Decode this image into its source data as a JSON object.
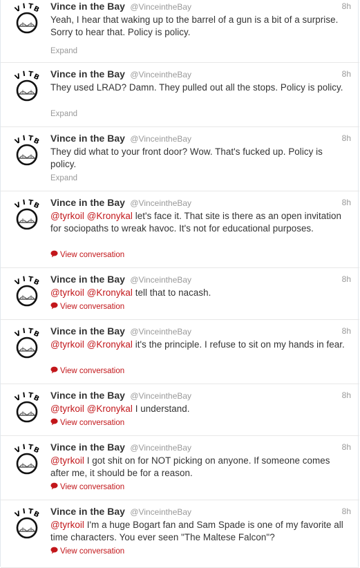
{
  "user": {
    "fullname": "Vince in the Bay",
    "username": "@VinceintheBay",
    "avatar_letters": [
      "V",
      "I",
      "T",
      "B"
    ]
  },
  "labels": {
    "expand": "Expand",
    "view_conversation": "View conversation"
  },
  "colors": {
    "link": "#c2161a",
    "muted": "#999999",
    "text": "#333333"
  },
  "icons": {
    "conversation": "speech-bubble-icon"
  },
  "tweets": [
    {
      "time": "8h",
      "mentions": [],
      "text": "Yeah, I hear that waking up to the barrel of a gun is a bit of a surprise. Sorry to hear that. Policy is policy.",
      "action": "expand"
    },
    {
      "time": "8h",
      "mentions": [],
      "text": "They used LRAD? Damn. They pulled out all the stops. Policy is policy.",
      "action": "expand"
    },
    {
      "time": "8h",
      "mentions": [],
      "text": "They did what to your front door? Wow. That's fucked up. Policy is policy.",
      "action": "expand"
    },
    {
      "time": "8h",
      "mentions": [
        "@tyrkoil",
        "@Kronykal"
      ],
      "text": "let's face it. That site is there as an open invitation for sociopaths to wreak havoc. It's not for educational purposes.",
      "action": "conversation"
    },
    {
      "time": "8h",
      "mentions": [
        "@tyrkoil",
        "@Kronykal"
      ],
      "text": "tell that to nacash.",
      "action": "conversation"
    },
    {
      "time": "8h",
      "mentions": [
        "@tyrkoil",
        "@Kronykal"
      ],
      "text": "it's the principle. I refuse to sit on my hands in fear.",
      "action": "conversation"
    },
    {
      "time": "8h",
      "mentions": [
        "@tyrkoil",
        "@Kronykal"
      ],
      "text": "I understand.",
      "action": "conversation"
    },
    {
      "time": "8h",
      "mentions": [
        "@tyrkoil"
      ],
      "text": "I got shit on for NOT picking on anyone. If someone comes after me, it should be for a reason.",
      "action": "conversation"
    },
    {
      "time": "8h",
      "mentions": [
        "@tyrkoil"
      ],
      "text": "I'm a huge Bogart fan and Sam Spade is one of my favorite all time characters. You ever seen \"The Maltese Falcon\"?",
      "action": "conversation"
    }
  ]
}
